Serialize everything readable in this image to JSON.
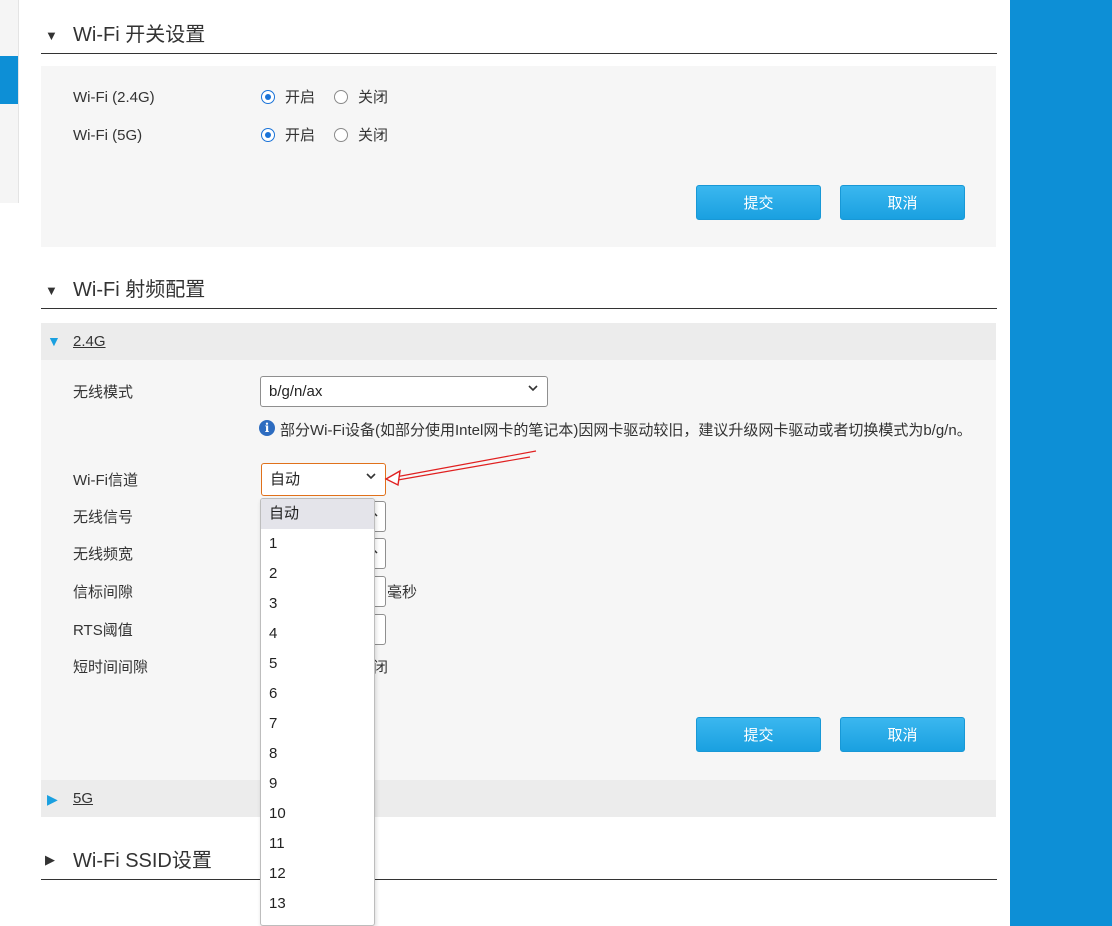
{
  "switch_section": {
    "title": "Wi-Fi 开关设置",
    "rows": [
      {
        "label": "Wi-Fi (2.4G)",
        "on_label": "开启",
        "off_label": "关闭",
        "selected": "on"
      },
      {
        "label": "Wi-Fi (5G)",
        "on_label": "开启",
        "off_label": "关闭",
        "selected": "on"
      }
    ],
    "submit_label": "提交",
    "cancel_label": "取消"
  },
  "rf_section": {
    "title": "Wi-Fi 射频配置",
    "band_24": {
      "label": "2.4G",
      "mode_label": "无线模式",
      "mode_value": "b/g/n/ax",
      "mode_note": "部分Wi-Fi设备(如部分使用Intel网卡的笔记本)因网卡驱动较旧，建议升级网卡驱动或者切换模式为b/g/n。",
      "channel_label": "Wi-Fi信道",
      "channel_value": "自动",
      "channel_options": [
        "自动",
        "1",
        "2",
        "3",
        "4",
        "5",
        "6",
        "7",
        "8",
        "9",
        "10",
        "11",
        "12",
        "13"
      ],
      "signal_label": "无线信号",
      "bandwidth_label": "无线频宽",
      "beacon_label": "信标间隙",
      "beacon_unit": "毫秒",
      "rts_label": "RTS阈值",
      "short_gi_label": "短时间间隙",
      "short_gi_trailing": "关闭",
      "submit_label": "提交",
      "cancel_label": "取消"
    },
    "band_5": {
      "label": "5G"
    }
  },
  "ssid_section": {
    "title": "Wi-Fi SSID设置"
  },
  "colors": {
    "accent": "#0d8fd6",
    "button": "#1aa0e0",
    "annotation": "#e02020"
  }
}
